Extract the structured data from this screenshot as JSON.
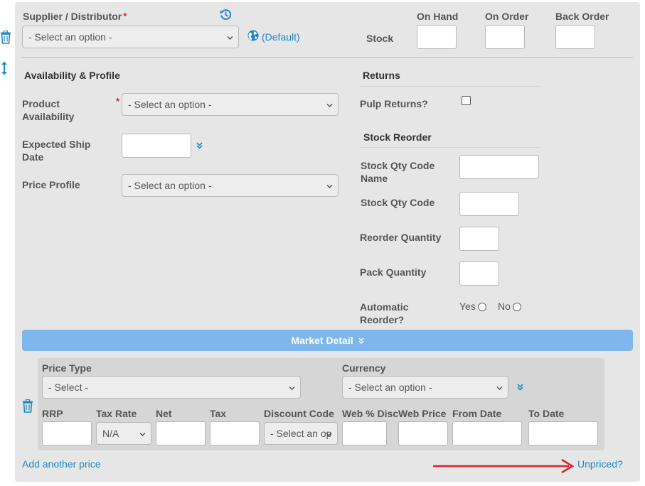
{
  "supplier": {
    "label": "Supplier / Distributor",
    "required_mark": "*",
    "select_value": "- Select an option -",
    "default_link": "(Default)",
    "stock_label": "Stock",
    "on_hand_label": "On Hand",
    "on_order_label": "On Order",
    "back_order_label": "Back Order"
  },
  "availability": {
    "heading": "Availability & Profile",
    "product_availability_label": "Product Availability",
    "product_availability_required": "*",
    "product_availability_value": "- Select an option -",
    "expected_ship_date_label": "Expected Ship Date",
    "price_profile_label": "Price Profile",
    "price_profile_value": "- Select an option -"
  },
  "returns": {
    "heading": "Returns",
    "pulp_returns_label": "Pulp Returns?"
  },
  "stock_reorder": {
    "heading": "Stock Reorder",
    "stock_qty_code_name_label": "Stock Qty Code Name",
    "stock_qty_code_label": "Stock Qty Code",
    "reorder_quantity_label": "Reorder Quantity",
    "pack_quantity_label": "Pack Quantity",
    "automatic_reorder_label": "Automatic Reorder?",
    "yes_label": "Yes",
    "no_label": "No"
  },
  "market_detail": {
    "bar_label": "Market Detail",
    "price_type_label": "Price Type",
    "price_type_value": "- Select -",
    "currency_label": "Currency",
    "currency_value": "- Select an option -",
    "columns": {
      "rrp": "RRP",
      "tax_rate": "Tax Rate",
      "net": "Net",
      "tax": "Tax",
      "discount_code": "Discount Code",
      "web_disc": "Web % Disc",
      "web_price": "Web Price",
      "from_date": "From Date",
      "to_date": "To Date"
    },
    "tax_rate_value": "N/A",
    "discount_code_value": "- Select an op"
  },
  "footer": {
    "add_price_link": "Add another price",
    "unpriced_link": "Unpriced?"
  },
  "colors": {
    "accent": "#1e88c7",
    "required": "#d9232e",
    "bar": "#7db7ec",
    "arrow": "#d9232e"
  }
}
